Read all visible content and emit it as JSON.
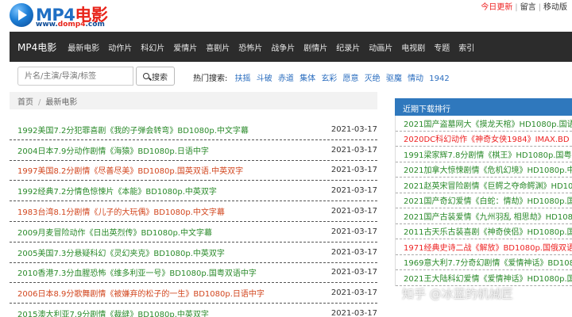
{
  "logo": {
    "text_en": "MP4",
    "text_cn": "电影",
    "url_prefix": "www.",
    "url_domain": "domp4",
    "url_suffix": ".com"
  },
  "toplinks": {
    "update": "今日更新",
    "message": "留言",
    "mobile": "移动版",
    "sep": "|"
  },
  "nav": {
    "brand": "MP4电影",
    "items": [
      "最新电影",
      "动作片",
      "科幻片",
      "爱情片",
      "喜剧片",
      "恐怖片",
      "战争片",
      "剧情片",
      "纪录片",
      "动画片",
      "电视剧",
      "专题",
      "索引"
    ]
  },
  "search": {
    "placeholder": "片名/主演/导演/标签",
    "button_label": "搜索",
    "hot_label": "热门搜索:",
    "hot_words": [
      "扶摇",
      "斗破",
      "赤道",
      "集体",
      "玄彩",
      "愿意",
      "灭绝",
      "驱魔",
      "情动",
      "1942"
    ]
  },
  "breadcrumb": {
    "home": "首页",
    "sep": "/",
    "current": "最新电影"
  },
  "movies": [
    {
      "title": "1992美国7.2分犯罪喜剧《我的子弹会转弯》BD1080p.中文字幕",
      "date": "2021-03-17",
      "color": "green"
    },
    {
      "title": "2004日本7.9分动作剧情《海猿》BD1080p.日语中字",
      "date": "2021-03-17",
      "color": "green"
    },
    {
      "title": "1997美国8.2分剧情《尽善尽美》BD1080p.国英双语.中英双字",
      "date": "2021-03-17",
      "color": "red"
    },
    {
      "title": "1992经典7.2分情色惊悚片《本能》BD1080p.中英双字",
      "date": "2021-03-17",
      "color": "green"
    },
    {
      "title": "1983台湾8.1分剧情《儿子的大玩偶》BD1080p.中文字幕",
      "date": "2021-03-17",
      "color": "red"
    },
    {
      "title": "2009月麦冒险动作《日出英烈传》BD1080p.中文字幕",
      "date": "2021-03-17",
      "color": "green"
    },
    {
      "title": "2005美国7.3分悬疑科幻《灵幻夹克》BD1080p.中英双字",
      "date": "2021-03-17",
      "color": "green"
    },
    {
      "title": "2010香港7.3分血腥恐怖《维多利亚一号》BD1080p.国粤双语中字",
      "date": "2021-03-17",
      "color": "green"
    },
    {
      "title": "2006日本8.9分歌舞剧情《被嫌弃的松子的一生》BD1080p.日语中字",
      "date": "2021-03-17",
      "color": "red"
    },
    {
      "title": "2015澳大利亚7.9分剧情《裁缝》BD1080p.中英双字",
      "date": "2021-03-17",
      "color": "green"
    }
  ],
  "sidebar": {
    "title": "近期下载排行",
    "items": [
      {
        "text": "2021国产盗墓网大《摸龙天棺》HD1080p.国语",
        "color": "green"
      },
      {
        "text": "2020DC科幻动作《神奇女侠1984》IMAX.BD",
        "color": "red"
      },
      {
        "text": "1991梁家辉7.8分剧情《棋王》HD1080p.国粤",
        "color": "green"
      },
      {
        "text": "2021加拿大惊悚剧情《危机幻境》HD1080p.中",
        "color": "green"
      },
      {
        "text": "2021赵英宋冒险剧情《巨鳄之夺命鳄渊》HD10",
        "color": "green"
      },
      {
        "text": "2021国产奇幻爱情《白蛇：情劫》HD1080p.国",
        "color": "green"
      },
      {
        "text": "2021国产古装爱情《九州羽乱 相思劫》HD1080",
        "color": "green"
      },
      {
        "text": "2011古天乐古装喜剧《神奇侠侣》HD1080p.国",
        "color": "green"
      },
      {
        "text": "1971经典史诗二战《解放》BD1080p.国俄双语",
        "color": "red"
      },
      {
        "text": "1969意大利7.7分奇幻剧情《爱情神话》BD1080",
        "color": "green"
      },
      {
        "text": "2021王大陆科幻爱情《爱情神话》HD1080p.国",
        "color": "green"
      }
    ]
  },
  "watermark": "知乎 @冰蓝的机械匠"
}
